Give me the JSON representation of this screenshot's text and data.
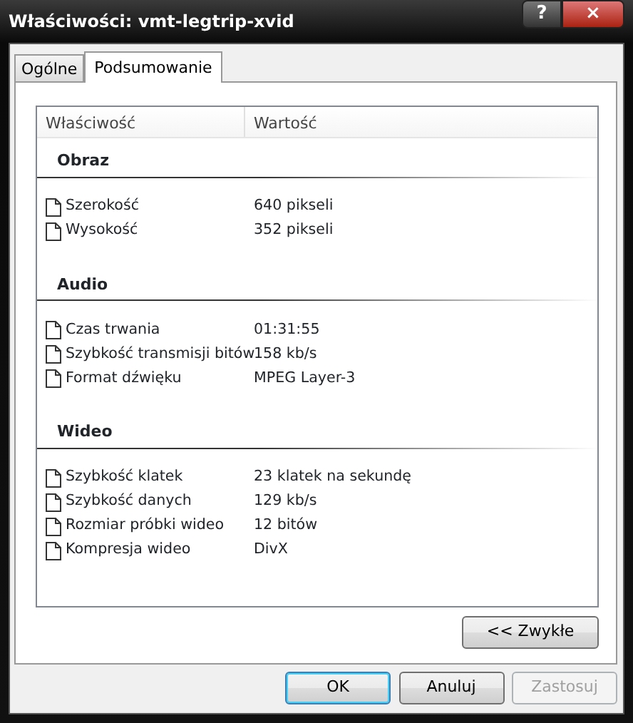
{
  "window": {
    "title": "Właściwości: vmt-legtrip-xvid",
    "help": "?",
    "close": "×"
  },
  "tabs": [
    {
      "label": "Ogólne",
      "selected": false
    },
    {
      "label": "Podsumowanie",
      "selected": true
    }
  ],
  "list": {
    "columns": [
      "Właściwość",
      "Wartość"
    ],
    "groups": [
      {
        "title": "Obraz",
        "rows": [
          {
            "name": "Szerokość",
            "value": "640 pikseli"
          },
          {
            "name": "Wysokość",
            "value": "352 pikseli"
          }
        ]
      },
      {
        "title": "Audio",
        "rows": [
          {
            "name": "Czas trwania",
            "value": "01:31:55"
          },
          {
            "name": "Szybkość transmisji bitów",
            "value": "158 kb/s"
          },
          {
            "name": "Format dźwięku",
            "value": "MPEG Layer-3"
          }
        ]
      },
      {
        "title": "Wideo",
        "rows": [
          {
            "name": "Szybkość klatek",
            "value": "23 klatek na sekundę"
          },
          {
            "name": "Szybkość danych",
            "value": "129 kb/s"
          },
          {
            "name": "Rozmiar próbki wideo",
            "value": "12 bitów"
          },
          {
            "name": "Kompresja wideo",
            "value": "DivX"
          }
        ]
      }
    ]
  },
  "toggle_button": "<< Zwykłe",
  "buttons": [
    {
      "label": "OK",
      "default": true,
      "disabled": false
    },
    {
      "label": "Anuluj",
      "default": false,
      "disabled": false
    },
    {
      "label": "Zastosuj",
      "default": false,
      "disabled": true
    }
  ]
}
